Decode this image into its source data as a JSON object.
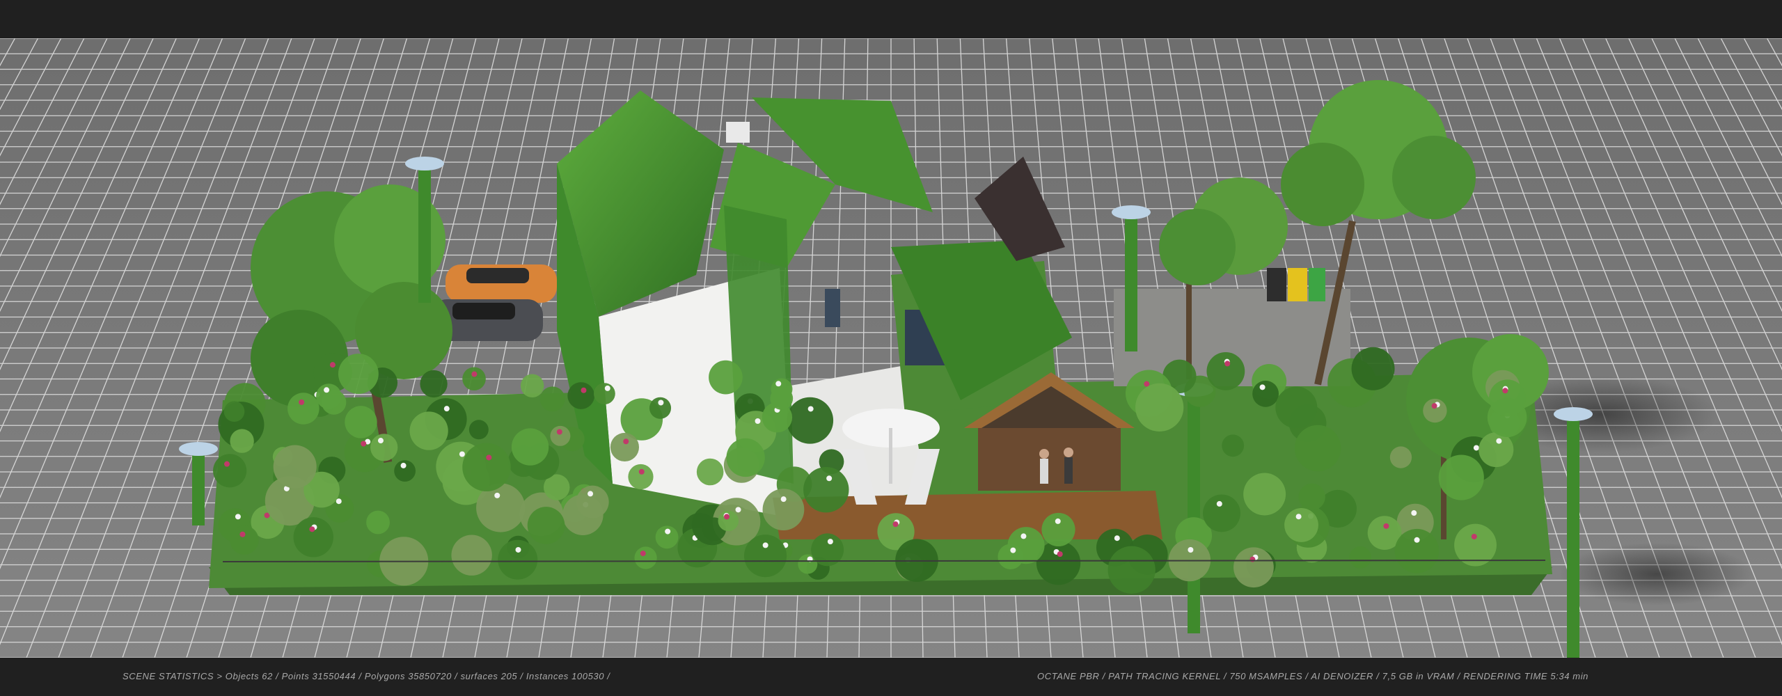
{
  "footer": {
    "scene_statistics": "SCENE STATISTICS > Objects 62 / Points 31550444 / Polygons 35850720 / surfaces 205 / Instances 100530 /",
    "render_info": "OCTANE PBR / PATH TRACING KERNEL / 750 MSAMPLES / AI DENOIZER / 7,5 GB in VRAM / RENDERING TIME 5:34 min"
  },
  "colors": {
    "frame_bar": "#202020",
    "grid_ground": "#7a7a7a",
    "grid_line": "#e6e6e6",
    "foliage": "#3f8a2c",
    "foliage_dark": "#2a5e1c",
    "wall": "#f2f2f0",
    "deck": "#8a5a2e",
    "stats_text": "#a9a9a9"
  }
}
